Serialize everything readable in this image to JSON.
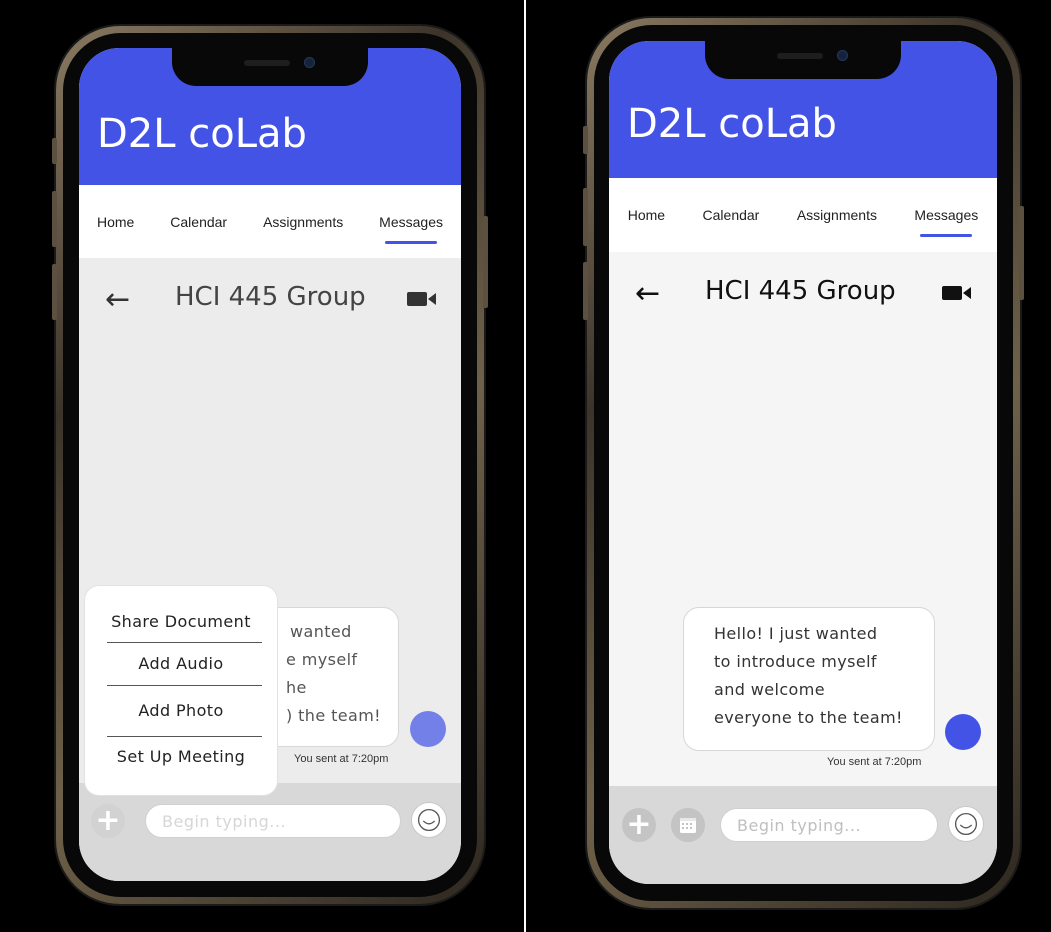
{
  "screens": [
    {
      "id": "menu-open",
      "app_title": "D2L coLab",
      "tabs": [
        {
          "label": "Home",
          "active": false
        },
        {
          "label": "Calendar",
          "active": false
        },
        {
          "label": "Assignments",
          "active": false
        },
        {
          "label": "Messages",
          "active": true
        }
      ],
      "conversation_title": "HCI 445 Group",
      "message_lines_partial": [
        "wanted",
        "e myself",
        "he",
        ") the team!"
      ],
      "sent_time": "You sent at 7:20pm",
      "attach_menu": [
        "Share Document",
        "Add Audio",
        "Add Photo",
        "Set Up Meeting"
      ],
      "input_placeholder": "Begin typing..."
    },
    {
      "id": "menu-closed",
      "app_title": "D2L coLab",
      "tabs": [
        {
          "label": "Home",
          "active": false
        },
        {
          "label": "Calendar",
          "active": false
        },
        {
          "label": "Assignments",
          "active": false
        },
        {
          "label": "Messages",
          "active": true
        }
      ],
      "conversation_title": "HCI 445 Group",
      "message_lines": [
        "Hello! I just wanted",
        "to introduce myself",
        "and welcome",
        "everyone to the team!"
      ],
      "sent_time": "You sent at 7:20pm",
      "input_placeholder": "Begin typing..."
    }
  ],
  "colors": {
    "accent": "#4353e6",
    "avatar_dimmed": "#7380e8",
    "composer_bg": "#d8d8d8"
  },
  "icons": {
    "back": "left-arrow-icon",
    "video": "video-camera-icon",
    "add": "plus-icon",
    "calendar": "calendar-icon",
    "emoji": "smiley-face-icon"
  }
}
